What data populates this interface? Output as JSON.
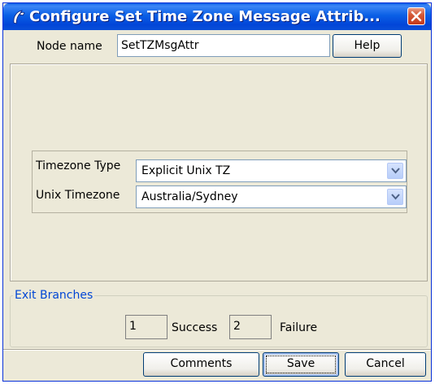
{
  "window": {
    "title": "Configure Set Time Zone Message Attrib...",
    "close_icon": "close-icon",
    "app_icon": "phone-handset-icon"
  },
  "node": {
    "label": "Node name",
    "value": "SetTZMsgAttr",
    "help_label": "Help"
  },
  "config": {
    "timezone_type_label": "Timezone Type",
    "timezone_type_value": "Explicit Unix TZ",
    "unix_timezone_label": "Unix Timezone",
    "unix_timezone_value": "Australia/Sydney"
  },
  "exit_branches": {
    "legend": "Exit Branches",
    "branches": [
      {
        "number": "1",
        "label": "Success"
      },
      {
        "number": "2",
        "label": "Failure"
      }
    ]
  },
  "buttons": {
    "comments": "Comments",
    "save": "Save",
    "cancel": "Cancel"
  }
}
